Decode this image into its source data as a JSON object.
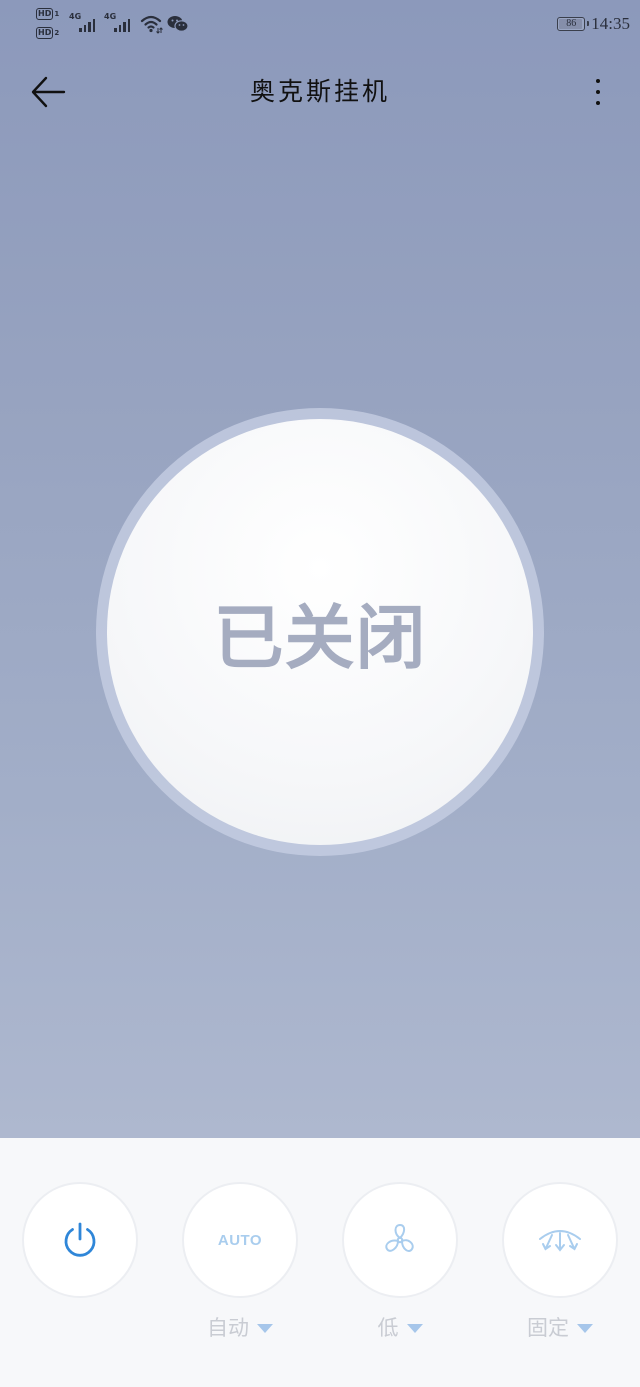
{
  "status_bar": {
    "sim1": "HD",
    "sim1_index": "1",
    "sim2": "HD",
    "sim2_index": "2",
    "network1": "4G",
    "network2": "4G",
    "battery_level": "86",
    "time": "14:35"
  },
  "header": {
    "title": "奥克斯挂机"
  },
  "main": {
    "power_status": "已关闭"
  },
  "controls": {
    "power": {
      "icon": "power-icon"
    },
    "mode": {
      "icon_text": "AUTO",
      "label": "自动"
    },
    "fan_speed": {
      "icon": "fan-icon",
      "label": "低"
    },
    "swing": {
      "icon": "swing-icon",
      "label": "固定"
    }
  },
  "colors": {
    "power_blue": "#2f86d8",
    "disabled_blue": "#a9cdee",
    "status_text": "#a5acc0"
  }
}
